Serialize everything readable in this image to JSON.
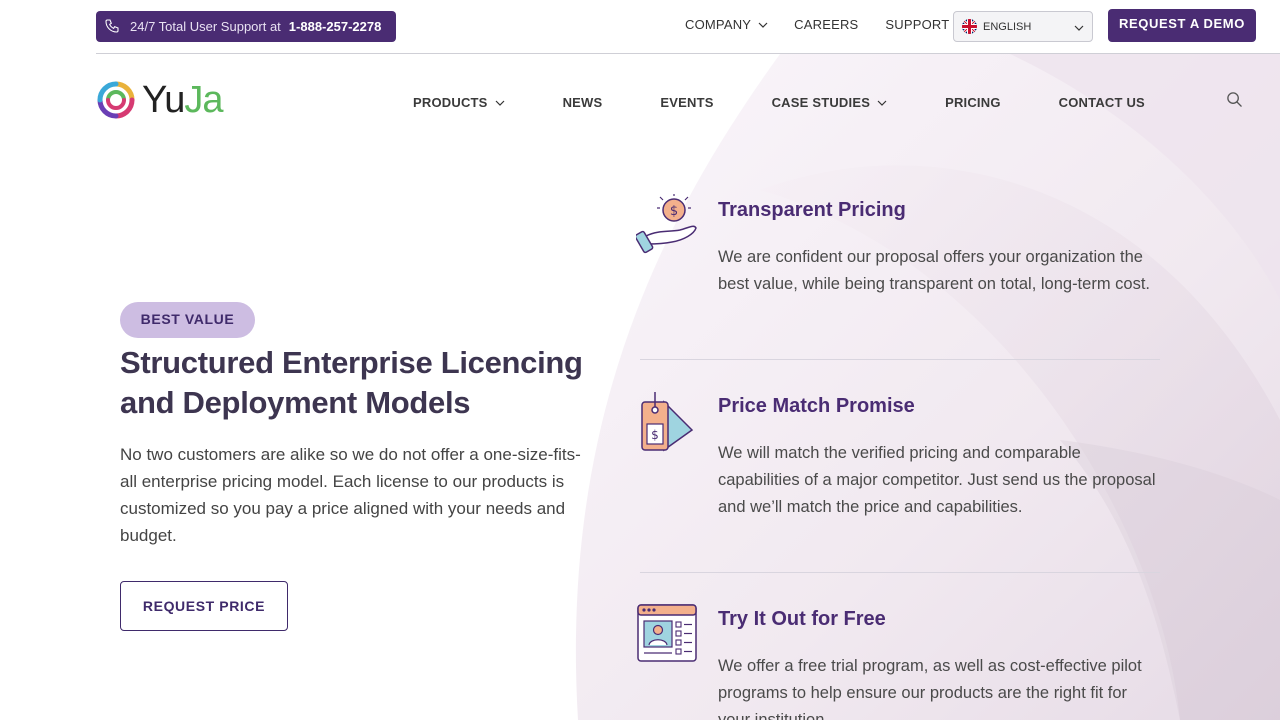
{
  "topbar": {
    "support_label": "24/7 Total User Support at",
    "support_phone": "1-888-257-2278",
    "links": {
      "company": "COMPANY",
      "careers": "CAREERS",
      "support": "SUPPORT"
    },
    "language": "ENGLISH",
    "demo_button": "REQUEST A DEMO"
  },
  "logo": {
    "part1": "Yu",
    "part2": "Ja"
  },
  "nav": {
    "products": "PRODUCTS",
    "news": "NEWS",
    "events": "EVENTS",
    "case_studies": "CASE STUDIES",
    "pricing": "PRICING",
    "contact": "CONTACT US"
  },
  "hero": {
    "badge": "BEST VALUE",
    "title": "Structured Enterprise Licencing and Deployment Models",
    "description": "No two customers are alike so we do not offer a one-size-fits-all enterprise pricing model. Each license to our products is customized so you pay a price aligned with your needs and budget.",
    "cta": "REQUEST PRICE"
  },
  "features": [
    {
      "title": "Transparent Pricing",
      "description": "We are confident our proposal offers your organization the best value, while being transparent on total, long-term cost.",
      "icon": "hand-coin-icon"
    },
    {
      "title": "Price Match Promise",
      "description": "We will match the verified pricing and comparable capabilities of a major competitor. Just send us the proposal and we’ll match the price and capabilities.",
      "icon": "price-tag-icon"
    },
    {
      "title": "Try It Out for Free",
      "description": "We offer a free trial program, as well as cost-effective pilot programs to help ensure our products are the right fit for your institution.",
      "icon": "browser-profile-icon"
    }
  ],
  "colors": {
    "brand_purple": "#4a2c73",
    "badge_bg": "#cdbde2",
    "logo_green": "#5cb85c"
  }
}
